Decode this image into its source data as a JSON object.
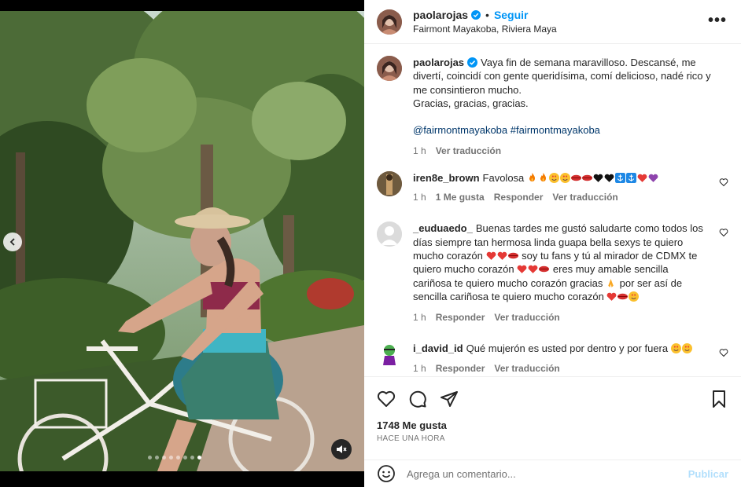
{
  "header": {
    "username": "paolarojas",
    "follow_label": "Seguir",
    "separator": "•",
    "location": "Fairmont Mayakoba, Riviera Maya",
    "more_label": "•••"
  },
  "caption": {
    "username": "paolarojas",
    "text1": "Vaya fin de semana maravilloso. Descansé, me divertí, coincidí con gente queridísima, comí delicioso, nadé rico y me consintieron mucho.",
    "text2": "Gracias, gracias, gracias.",
    "tags": "@fairmontmayakoba #fairmontmayakoba",
    "time": "1 h",
    "translate": "Ver traducción"
  },
  "comments": [
    {
      "username": "iren8e_brown",
      "text": "Favolosa",
      "time": "1 h",
      "likes": "1 Me gusta",
      "reply": "Responder",
      "translate": "Ver traducción"
    },
    {
      "username": "_euduaedo_",
      "text_a": "Buenas tardes me gustó saludarte como todos los días siempre tan hermosa linda guapa bella sexys te quiero mucho corazón",
      "text_b": "soy tu fans y tú al mirador de CDMX te quiero mucho corazón",
      "text_c": "eres muy amable sencilla cariñosa te quiero mucho corazón gracias",
      "text_d": "por ser así de sencilla cariñosa te quiero mucho corazón",
      "time": "1 h",
      "reply": "Responder",
      "translate": "Ver traducción"
    },
    {
      "username": "i_david_id",
      "text": "Qué mujerón es usted por dentro y por fuera",
      "time": "1 h",
      "reply": "Responder",
      "translate": "Ver traducción"
    }
  ],
  "actions": {
    "likes": "1748 Me gusta",
    "timestamp": "Hace una hora"
  },
  "add_comment": {
    "placeholder": "Agrega un comentario...",
    "post_label": "Publicar"
  },
  "media": {
    "carousel_count": 8,
    "carousel_active": 8
  },
  "colors": {
    "accent": "#0095f6",
    "link": "#00376b",
    "muted": "#737373",
    "heart_red": "#ed4956"
  }
}
